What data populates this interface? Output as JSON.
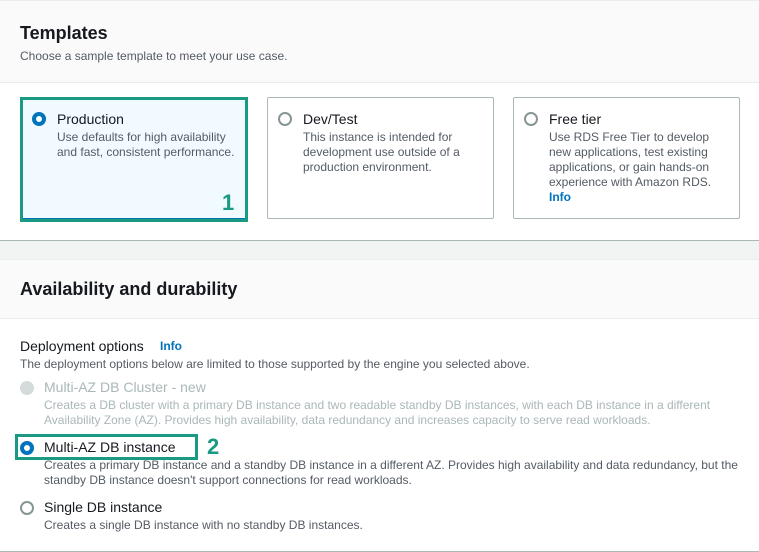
{
  "templates": {
    "title": "Templates",
    "description": "Choose a sample template to meet your use case.",
    "options": [
      {
        "label": "Production",
        "description": "Use defaults for high availability and fast, consistent performance.",
        "selected": true
      },
      {
        "label": "Dev/Test",
        "description": "This instance is intended for development use outside of a production environment.",
        "selected": false
      },
      {
        "label": "Free tier",
        "description": "Use RDS Free Tier to develop new applications, test existing applications, or gain hands-on experience with Amazon RDS.",
        "info": "Info",
        "selected": false
      }
    ]
  },
  "availability": {
    "title": "Availability and durability",
    "deployment_label": "Deployment options",
    "info": "Info",
    "deployment_description": "The deployment options below are limited to those supported by the engine you selected above.",
    "options": [
      {
        "label": "Multi-AZ DB Cluster - new",
        "description": "Creates a DB cluster with a primary DB instance and two readable standby DB instances, with each DB instance in a different Availability Zone (AZ). Provides high availability, data redundancy and increases capacity to serve read workloads.",
        "state": "disabled"
      },
      {
        "label": "Multi-AZ DB instance",
        "description": "Creates a primary DB instance and a standby DB instance in a different AZ. Provides high availability and data redundancy, but the standby DB instance doesn't support connections for read workloads.",
        "state": "selected"
      },
      {
        "label": "Single DB instance",
        "description": "Creates a single DB instance with no standby DB instances.",
        "state": "unselected"
      }
    ]
  },
  "annotations": {
    "marker1": "1",
    "marker2": "2"
  },
  "colors": {
    "accent": "#0073bb",
    "highlight": "#1a9a82",
    "text": "#16191f",
    "muted": "#545b64",
    "disabled": "#aab7b8"
  }
}
